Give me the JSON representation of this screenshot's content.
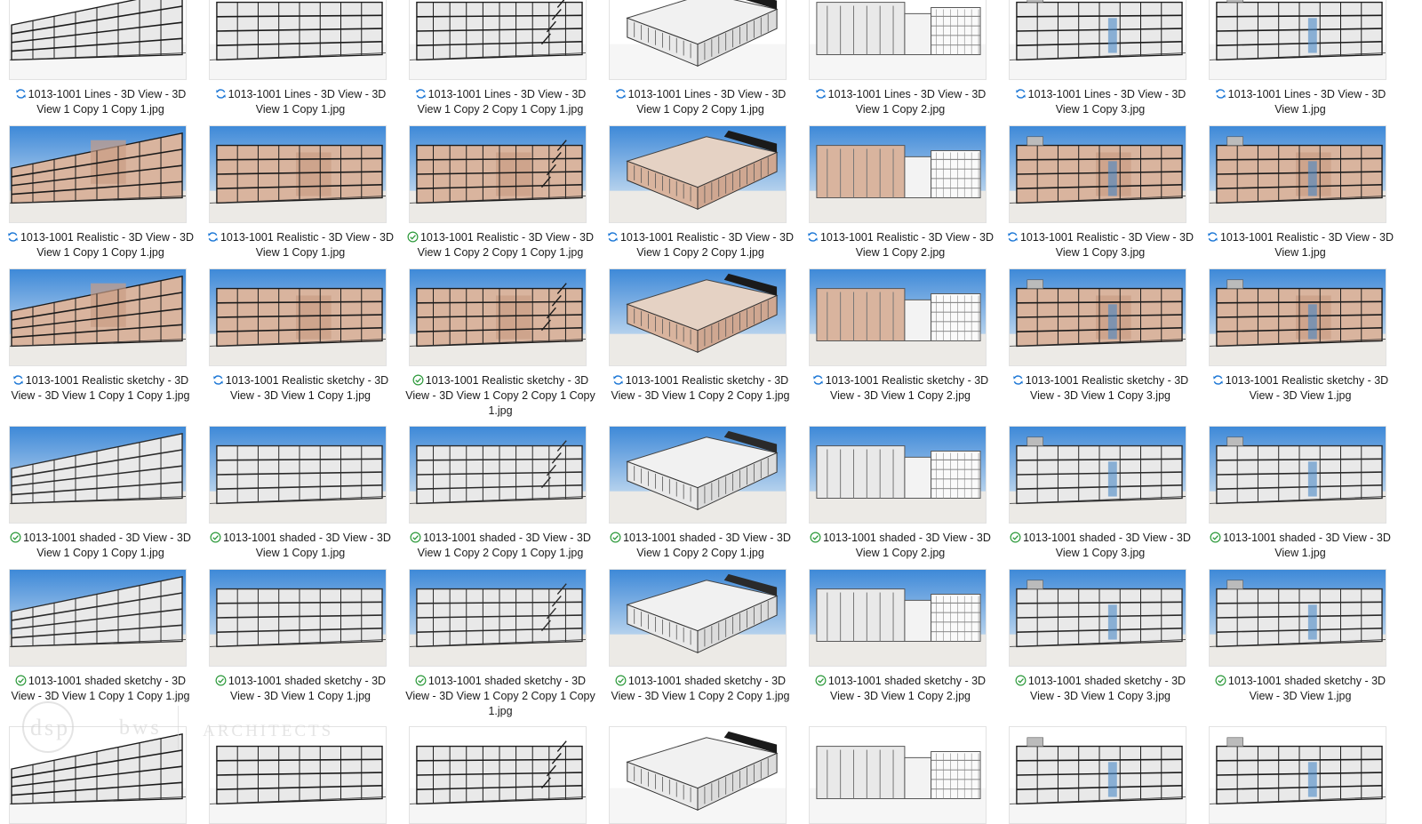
{
  "colors": {
    "sync_icon": "#1e78d6",
    "ok_icon": "#2e9a3c",
    "sky_top": "#3e89d8",
    "sky_bottom": "#eef4f7",
    "brick": "#d9b49e"
  },
  "watermark": {
    "logo": "dsp",
    "firm": "bws",
    "suffix": "ARCHITECTS"
  },
  "rows": [
    {
      "style": "lines",
      "items": [
        {
          "name": "1013-1001 Lines - 3D View - 3D View 1 Copy 1 Copy 1.jpg",
          "status": "sync-icon",
          "view": "long"
        },
        {
          "name": "1013-1001 Lines - 3D View - 3D View 1 Copy 1.jpg",
          "status": "sync-icon",
          "view": "front"
        },
        {
          "name": "1013-1001 Lines - 3D View - 3D View 1 Copy 2 Copy 1 Copy 1.jpg",
          "status": "sync-icon",
          "view": "stair"
        },
        {
          "name": "1013-1001 Lines - 3D View - 3D View 1 Copy 2 Copy 1.jpg",
          "status": "sync-icon",
          "view": "aerial"
        },
        {
          "name": "1013-1001 Lines - 3D View - 3D View 1 Copy 2.jpg",
          "status": "sync-icon",
          "view": "elev"
        },
        {
          "name": "1013-1001 Lines - 3D View - 3D View 1 Copy 3.jpg",
          "status": "sync-icon",
          "view": "section"
        },
        {
          "name": "1013-1001 Lines - 3D View - 3D View 1.jpg",
          "status": "sync-icon",
          "view": "section"
        }
      ]
    },
    {
      "style": "realistic",
      "items": [
        {
          "name": "1013-1001 Realistic - 3D View - 3D View 1 Copy 1 Copy 1.jpg",
          "status": "sync-icon",
          "view": "long"
        },
        {
          "name": "1013-1001 Realistic - 3D View - 3D View 1 Copy 1.jpg",
          "status": "sync-icon",
          "view": "front"
        },
        {
          "name": "1013-1001 Realistic - 3D View - 3D View 1 Copy 2 Copy 1 Copy 1.jpg",
          "status": "check-icon",
          "view": "stair"
        },
        {
          "name": "1013-1001 Realistic - 3D View - 3D View 1 Copy 2 Copy 1.jpg",
          "status": "sync-icon",
          "view": "aerial"
        },
        {
          "name": "1013-1001 Realistic - 3D View - 3D View 1 Copy 2.jpg",
          "status": "sync-icon",
          "view": "elev"
        },
        {
          "name": "1013-1001 Realistic - 3D View - 3D View 1 Copy 3.jpg",
          "status": "sync-icon",
          "view": "section"
        },
        {
          "name": "1013-1001 Realistic - 3D View - 3D View 1.jpg",
          "status": "sync-icon",
          "view": "section"
        }
      ]
    },
    {
      "style": "realistic-sketchy",
      "items": [
        {
          "name": "1013-1001 Realistic sketchy - 3D View - 3D View 1 Copy 1 Copy 1.jpg",
          "status": "sync-icon",
          "view": "long"
        },
        {
          "name": "1013-1001 Realistic sketchy - 3D View - 3D View 1 Copy 1.jpg",
          "status": "sync-icon",
          "view": "front"
        },
        {
          "name": "1013-1001 Realistic sketchy - 3D View - 3D View 1 Copy 2 Copy 1 Copy 1.jpg",
          "status": "check-icon",
          "view": "stair"
        },
        {
          "name": "1013-1001 Realistic sketchy - 3D View - 3D View 1 Copy 2 Copy 1.jpg",
          "status": "sync-icon",
          "view": "aerial"
        },
        {
          "name": "1013-1001 Realistic sketchy - 3D View - 3D View 1 Copy 2.jpg",
          "status": "sync-icon",
          "view": "elev"
        },
        {
          "name": "1013-1001 Realistic sketchy - 3D View - 3D View 1 Copy 3.jpg",
          "status": "sync-icon",
          "view": "section"
        },
        {
          "name": "1013-1001 Realistic sketchy - 3D View - 3D View 1.jpg",
          "status": "sync-icon",
          "view": "section"
        }
      ]
    },
    {
      "style": "shaded",
      "items": [
        {
          "name": "1013-1001 shaded - 3D View - 3D View 1 Copy 1 Copy 1.jpg",
          "status": "check-icon",
          "view": "long"
        },
        {
          "name": "1013-1001 shaded - 3D View - 3D View 1 Copy 1.jpg",
          "status": "check-icon",
          "view": "front"
        },
        {
          "name": "1013-1001 shaded - 3D View - 3D View 1 Copy 2 Copy 1 Copy 1.jpg",
          "status": "check-icon",
          "view": "stair"
        },
        {
          "name": "1013-1001 shaded - 3D View - 3D View 1 Copy 2 Copy 1.jpg",
          "status": "check-icon",
          "view": "aerial"
        },
        {
          "name": "1013-1001 shaded - 3D View - 3D View 1 Copy 2.jpg",
          "status": "check-icon",
          "view": "elev"
        },
        {
          "name": "1013-1001 shaded - 3D View - 3D View 1 Copy 3.jpg",
          "status": "check-icon",
          "view": "section"
        },
        {
          "name": "1013-1001 shaded - 3D View - 3D View 1.jpg",
          "status": "check-icon",
          "view": "section"
        }
      ]
    },
    {
      "style": "shaded-sketchy",
      "items": [
        {
          "name": "1013-1001 shaded sketchy - 3D View - 3D View 1 Copy 1 Copy 1.jpg",
          "status": "check-icon",
          "view": "long"
        },
        {
          "name": "1013-1001 shaded sketchy - 3D View - 3D View 1 Copy 1.jpg",
          "status": "check-icon",
          "view": "front"
        },
        {
          "name": "1013-1001 shaded sketchy - 3D View - 3D View 1 Copy 2 Copy 1 Copy 1.jpg",
          "status": "check-icon",
          "view": "stair"
        },
        {
          "name": "1013-1001 shaded sketchy - 3D View - 3D View 1 Copy 2 Copy 1.jpg",
          "status": "check-icon",
          "view": "aerial"
        },
        {
          "name": "1013-1001 shaded sketchy - 3D View - 3D View 1 Copy 2.jpg",
          "status": "check-icon",
          "view": "elev"
        },
        {
          "name": "1013-1001 shaded sketchy - 3D View - 3D View 1 Copy 3.jpg",
          "status": "check-icon",
          "view": "section"
        },
        {
          "name": "1013-1001 shaded sketchy - 3D View - 3D View 1.jpg",
          "status": "check-icon",
          "view": "section"
        }
      ]
    },
    {
      "style": "lines",
      "items": [
        {
          "name": "",
          "status": "",
          "view": "long"
        },
        {
          "name": "",
          "status": "",
          "view": "front"
        },
        {
          "name": "",
          "status": "",
          "view": "stair"
        },
        {
          "name": "",
          "status": "",
          "view": "aerial"
        },
        {
          "name": "",
          "status": "",
          "view": "elev"
        },
        {
          "name": "",
          "status": "",
          "view": "section"
        },
        {
          "name": "",
          "status": "",
          "view": "section"
        }
      ]
    }
  ]
}
